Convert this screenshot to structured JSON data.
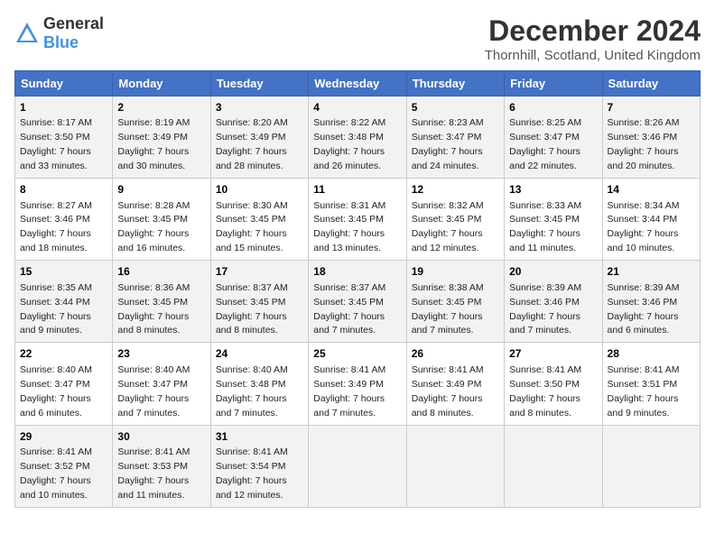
{
  "logo": {
    "text_general": "General",
    "text_blue": "Blue"
  },
  "title": "December 2024",
  "subtitle": "Thornhill, Scotland, United Kingdom",
  "days_of_week": [
    "Sunday",
    "Monday",
    "Tuesday",
    "Wednesday",
    "Thursday",
    "Friday",
    "Saturday"
  ],
  "weeks": [
    [
      {
        "day": "1",
        "sunrise": "8:17 AM",
        "sunset": "3:50 PM",
        "daylight": "7 hours and 33 minutes."
      },
      {
        "day": "2",
        "sunrise": "8:19 AM",
        "sunset": "3:49 PM",
        "daylight": "7 hours and 30 minutes."
      },
      {
        "day": "3",
        "sunrise": "8:20 AM",
        "sunset": "3:49 PM",
        "daylight": "7 hours and 28 minutes."
      },
      {
        "day": "4",
        "sunrise": "8:22 AM",
        "sunset": "3:48 PM",
        "daylight": "7 hours and 26 minutes."
      },
      {
        "day": "5",
        "sunrise": "8:23 AM",
        "sunset": "3:47 PM",
        "daylight": "7 hours and 24 minutes."
      },
      {
        "day": "6",
        "sunrise": "8:25 AM",
        "sunset": "3:47 PM",
        "daylight": "7 hours and 22 minutes."
      },
      {
        "day": "7",
        "sunrise": "8:26 AM",
        "sunset": "3:46 PM",
        "daylight": "7 hours and 20 minutes."
      }
    ],
    [
      {
        "day": "8",
        "sunrise": "8:27 AM",
        "sunset": "3:46 PM",
        "daylight": "7 hours and 18 minutes."
      },
      {
        "day": "9",
        "sunrise": "8:28 AM",
        "sunset": "3:45 PM",
        "daylight": "7 hours and 16 minutes."
      },
      {
        "day": "10",
        "sunrise": "8:30 AM",
        "sunset": "3:45 PM",
        "daylight": "7 hours and 15 minutes."
      },
      {
        "day": "11",
        "sunrise": "8:31 AM",
        "sunset": "3:45 PM",
        "daylight": "7 hours and 13 minutes."
      },
      {
        "day": "12",
        "sunrise": "8:32 AM",
        "sunset": "3:45 PM",
        "daylight": "7 hours and 12 minutes."
      },
      {
        "day": "13",
        "sunrise": "8:33 AM",
        "sunset": "3:45 PM",
        "daylight": "7 hours and 11 minutes."
      },
      {
        "day": "14",
        "sunrise": "8:34 AM",
        "sunset": "3:44 PM",
        "daylight": "7 hours and 10 minutes."
      }
    ],
    [
      {
        "day": "15",
        "sunrise": "8:35 AM",
        "sunset": "3:44 PM",
        "daylight": "7 hours and 9 minutes."
      },
      {
        "day": "16",
        "sunrise": "8:36 AM",
        "sunset": "3:45 PM",
        "daylight": "7 hours and 8 minutes."
      },
      {
        "day": "17",
        "sunrise": "8:37 AM",
        "sunset": "3:45 PM",
        "daylight": "7 hours and 8 minutes."
      },
      {
        "day": "18",
        "sunrise": "8:37 AM",
        "sunset": "3:45 PM",
        "daylight": "7 hours and 7 minutes."
      },
      {
        "day": "19",
        "sunrise": "8:38 AM",
        "sunset": "3:45 PM",
        "daylight": "7 hours and 7 minutes."
      },
      {
        "day": "20",
        "sunrise": "8:39 AM",
        "sunset": "3:46 PM",
        "daylight": "7 hours and 7 minutes."
      },
      {
        "day": "21",
        "sunrise": "8:39 AM",
        "sunset": "3:46 PM",
        "daylight": "7 hours and 6 minutes."
      }
    ],
    [
      {
        "day": "22",
        "sunrise": "8:40 AM",
        "sunset": "3:47 PM",
        "daylight": "7 hours and 6 minutes."
      },
      {
        "day": "23",
        "sunrise": "8:40 AM",
        "sunset": "3:47 PM",
        "daylight": "7 hours and 7 minutes."
      },
      {
        "day": "24",
        "sunrise": "8:40 AM",
        "sunset": "3:48 PM",
        "daylight": "7 hours and 7 minutes."
      },
      {
        "day": "25",
        "sunrise": "8:41 AM",
        "sunset": "3:49 PM",
        "daylight": "7 hours and 7 minutes."
      },
      {
        "day": "26",
        "sunrise": "8:41 AM",
        "sunset": "3:49 PM",
        "daylight": "7 hours and 8 minutes."
      },
      {
        "day": "27",
        "sunrise": "8:41 AM",
        "sunset": "3:50 PM",
        "daylight": "7 hours and 8 minutes."
      },
      {
        "day": "28",
        "sunrise": "8:41 AM",
        "sunset": "3:51 PM",
        "daylight": "7 hours and 9 minutes."
      }
    ],
    [
      {
        "day": "29",
        "sunrise": "8:41 AM",
        "sunset": "3:52 PM",
        "daylight": "7 hours and 10 minutes."
      },
      {
        "day": "30",
        "sunrise": "8:41 AM",
        "sunset": "3:53 PM",
        "daylight": "7 hours and 11 minutes."
      },
      {
        "day": "31",
        "sunrise": "8:41 AM",
        "sunset": "3:54 PM",
        "daylight": "7 hours and 12 minutes."
      },
      null,
      null,
      null,
      null
    ]
  ]
}
